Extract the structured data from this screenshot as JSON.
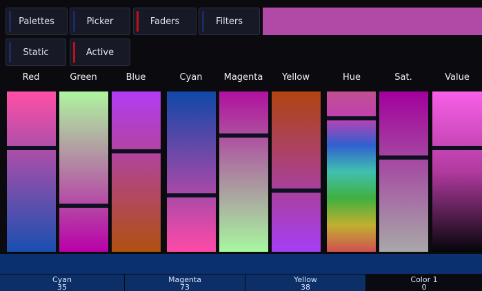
{
  "tabs": {
    "palettes": "Palettes",
    "picker": "Picker",
    "faders": "Faders",
    "filters": "Filters",
    "static": "Static",
    "active": "Active"
  },
  "current_color": "#b14aa6",
  "faders": [
    {
      "label": "Red",
      "value": 0.65,
      "gradient": [
        "#ff4fa6",
        "#1a4fb0"
      ]
    },
    {
      "label": "Green",
      "value": 0.28,
      "gradient": [
        "#aef5a0",
        "#b800a8"
      ]
    },
    {
      "label": "Blue",
      "value": 0.63,
      "gradient": [
        "#b33cf5",
        "#b05010"
      ]
    },
    {
      "label": "Cyan",
      "value": 0.35,
      "gradient": [
        "#1048a8",
        "#ff4aa8"
      ]
    },
    {
      "label": "Magenta",
      "value": 0.73,
      "gradient": [
        "#b0109f",
        "#a7f7a0"
      ]
    },
    {
      "label": "Yellow",
      "value": 0.38,
      "gradient": [
        "#b04410",
        "#a53ef5"
      ]
    },
    {
      "label": "Hue",
      "value": 0.84,
      "gradient": [
        "#c05090",
        "#c040b0",
        "#3060d0",
        "#40c0b0",
        "#40b040",
        "#c0b030",
        "#d05050"
      ]
    },
    {
      "label": "Sat.",
      "value": 0.59,
      "gradient": [
        "#a2009c",
        "#a8a8a8"
      ]
    },
    {
      "label": "Value",
      "value": 0.65,
      "gradient": [
        "#f860e8",
        "#b03a9e",
        "#05050a"
      ]
    }
  ],
  "encoders": [
    {
      "name": "Cyan",
      "value": "35"
    },
    {
      "name": "Magenta",
      "value": "73"
    },
    {
      "name": "Yellow",
      "value": "38"
    },
    {
      "name": "Color 1",
      "value": "0"
    }
  ]
}
